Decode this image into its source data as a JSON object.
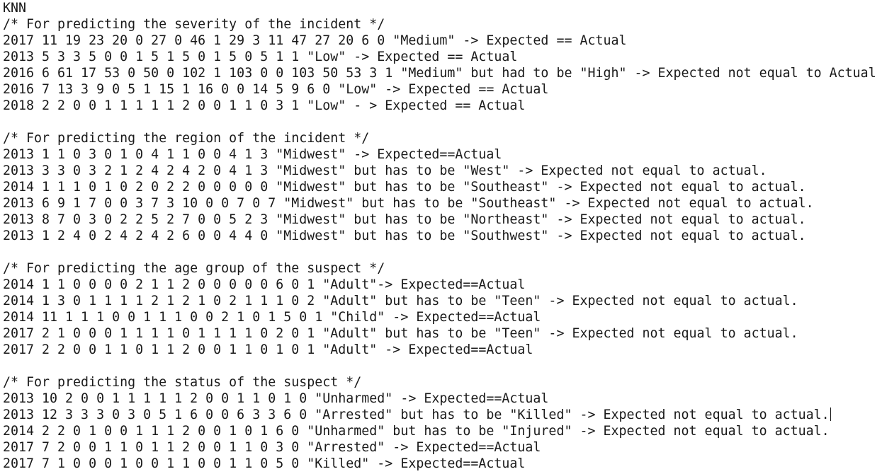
{
  "editor": {
    "lines": [
      "KNN",
      "/* For predicting the severity of the incident */",
      "2017 11 19 23 20 0 27 0 46 1 29 3 11 47 27 20 6 0 \"Medium\" -> Expected == Actual",
      "2013 5 3 3 5 0 0 1 5 1 5 0 1 5 0 5 1 1 \"Low\" -> Expected == Actual",
      "2016 6 61 17 53 0 50 0 102 1 103 0 0 103 50 53 3 1 \"Medium\" but had to be \"High\" -> Expected not equal to Actual",
      "2016 7 13 3 9 0 5 1 15 1 16 0 0 14 5 9 6 0 \"Low\" -> Expected == Actual",
      "2018 2 2 0 0 1 1 1 1 1 2 0 0 1 1 0 3 1 \"Low\" - > Expected == Actual",
      "",
      "/* For predicting the region of the incident */",
      "2013 1 1 0 3 0 1 0 4 1 1 0 0 4 1 3 \"Midwest\" -> Expected==Actual",
      "2013 3 3 0 3 2 1 2 4 2 4 2 0 4 1 3 \"Midwest\" but has to be \"West\" -> Expected not equal to actual.",
      "2014 1 1 1 0 1 0 2 0 2 2 0 0 0 0 0 \"Midwest\" but has to be \"Southeast\" -> Expected not equal to actual.",
      "2013 6 9 1 7 0 0 3 7 3 10 0 0 7 0 7 \"Midwest\" but has to be \"Southeast\" -> Expected not equal to actual.",
      "2013 8 7 0 3 0 2 2 5 2 7 0 0 5 2 3 \"Midwest\" but has to be \"Northeast\" -> Expected not equal to actual.",
      "2013 1 2 4 0 2 4 2 4 2 6 0 0 4 4 0 \"Midwest\" but has to be \"Southwest\" -> Expected not equal to actual.",
      "",
      "/* For predicting the age group of the suspect */",
      "2014 1 1 0 0 0 0 2 1 1 2 0 0 0 0 0 6 0 1 \"Adult\"-> Expected==Actual",
      "2014 1 3 0 1 1 1 1 2 1 2 1 0 2 1 1 1 0 2 \"Adult\" but has to be \"Teen\" -> Expected not equal to actual.",
      "2014 11 1 1 1 0 0 1 1 1 0 0 2 1 0 1 5 0 1 \"Child\" -> Expected==Actual",
      "2017 2 1 0 0 0 1 1 1 1 0 1 1 1 1 0 2 0 1 \"Adult\" but has to be \"Teen\" -> Expected not equal to actual.",
      "2017 2 2 0 0 1 1 0 1 1 2 0 0 1 1 0 1 0 1 \"Adult\" -> Expected==Actual",
      "",
      "/* For predicting the status of the suspect */",
      "2013 10 2 0 0 1 1 1 1 1 2 0 0 1 1 0 1 0 \"Unharmed\" -> Expected==Actual",
      "2013 12 3 3 3 0 3 0 5 1 6 0 0 6 3 3 6 0 \"Arrested\" but has to be \"Killed\" -> Expected not equal to actual.",
      "2014 2 2 0 1 0 0 1 1 1 2 0 0 1 0 1 6 0 \"Unharmed\" but has to be \"Injured\" -> Expected not equal to actual.",
      "2017 7 2 0 0 1 1 0 1 1 2 0 0 1 1 0 3 0 \"Arrested\" -> Expected==Actual",
      "2017 7 1 0 0 0 1 0 0 1 1 0 0 1 1 0 5 0 \"Killed\" -> Expected==Actual"
    ]
  }
}
